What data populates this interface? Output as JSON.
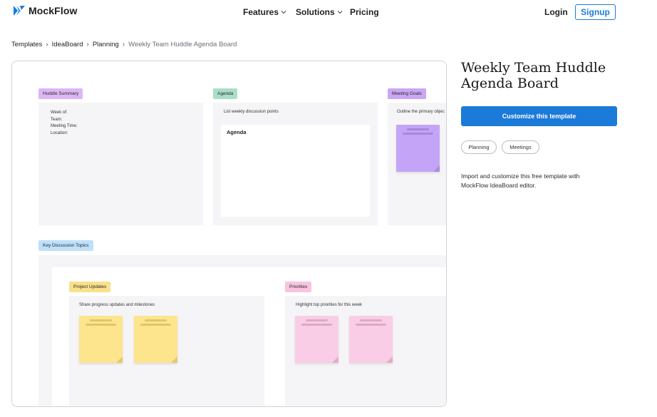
{
  "header": {
    "brand": "MockFlow",
    "nav": [
      {
        "label": "Features",
        "has_dropdown": true
      },
      {
        "label": "Solutions",
        "has_dropdown": true
      },
      {
        "label": "Pricing",
        "has_dropdown": false
      }
    ],
    "login_label": "Login",
    "signup_label": "Signup",
    "brand_color": "#1c7ad8"
  },
  "breadcrumb": {
    "items": [
      "Templates",
      "IdeaBoard",
      "Planning"
    ],
    "current": "Weekly Team Huddle Agenda Board"
  },
  "preview": {
    "huddle_summary": {
      "tag": "Huddle Summary",
      "tag_color": "#dcb6f5",
      "fields": [
        "Week of:",
        "Team:",
        "Meeting Time:",
        "Location:"
      ]
    },
    "agenda": {
      "tag": "Agenda",
      "tag_color": "#a9dfc8",
      "hint": "List weekly discussion points",
      "card_title": "Agenda"
    },
    "meeting_goals": {
      "tag": "Meeting Goals",
      "tag_color": "#caa6f3",
      "hint": "Outline the primary objec",
      "sticky_color": "#c4a4f7"
    },
    "key_topics": {
      "tag": "Key Discussion Topics",
      "tag_color": "#bfe0fb"
    },
    "project_updates": {
      "tag": "Project Updates",
      "tag_color": "#f9e08a",
      "hint": "Share progress updates and milestones",
      "sticky_color": "#fce58c"
    },
    "priorities": {
      "tag": "Priorities",
      "tag_color": "#f8c4df",
      "hint": "Highlight top priorities for this week",
      "sticky_color": "#f9cde5"
    }
  },
  "details": {
    "title": "Weekly Team Huddle Agenda Board",
    "cta_label": "Customize this template",
    "tags": [
      "Planning",
      "Meetings"
    ],
    "description": "Import and customize this free template with MockFlow IdeaBoard editor."
  }
}
